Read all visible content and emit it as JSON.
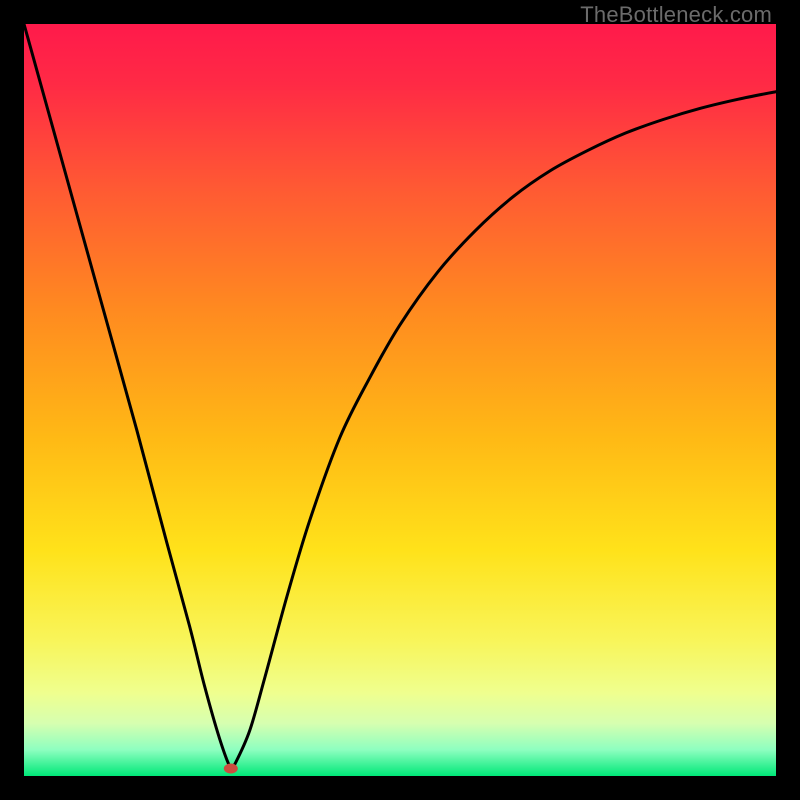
{
  "watermark": "TheBottleneck.com",
  "chart_data": {
    "type": "line",
    "title": "",
    "xlabel": "",
    "ylabel": "",
    "xlim": [
      0,
      100
    ],
    "ylim": [
      0,
      100
    ],
    "grid": false,
    "series": [
      {
        "name": "curve",
        "x": [
          0,
          5,
          10,
          15,
          19,
          22,
          24,
          26,
          27.5,
          28,
          30,
          32,
          35,
          38,
          42,
          46,
          50,
          55,
          60,
          65,
          70,
          75,
          80,
          85,
          90,
          95,
          100
        ],
        "values": [
          100,
          82,
          64,
          46,
          31,
          20,
          12,
          5,
          1,
          1.5,
          6,
          13,
          24,
          34,
          45,
          53,
          60,
          67,
          72.5,
          77,
          80.5,
          83.2,
          85.5,
          87.3,
          88.8,
          90,
          91
        ]
      }
    ],
    "marker": {
      "x": 27.5,
      "y": 1
    },
    "background_gradient": {
      "stops": [
        {
          "offset": 0,
          "color": "#ff1a4b"
        },
        {
          "offset": 0.08,
          "color": "#ff2a45"
        },
        {
          "offset": 0.22,
          "color": "#ff5a33"
        },
        {
          "offset": 0.38,
          "color": "#ff8a20"
        },
        {
          "offset": 0.55,
          "color": "#ffb915"
        },
        {
          "offset": 0.7,
          "color": "#ffe21a"
        },
        {
          "offset": 0.82,
          "color": "#f8f55a"
        },
        {
          "offset": 0.89,
          "color": "#efff8f"
        },
        {
          "offset": 0.93,
          "color": "#d6ffb0"
        },
        {
          "offset": 0.965,
          "color": "#8effc0"
        },
        {
          "offset": 1.0,
          "color": "#00e878"
        }
      ]
    }
  }
}
